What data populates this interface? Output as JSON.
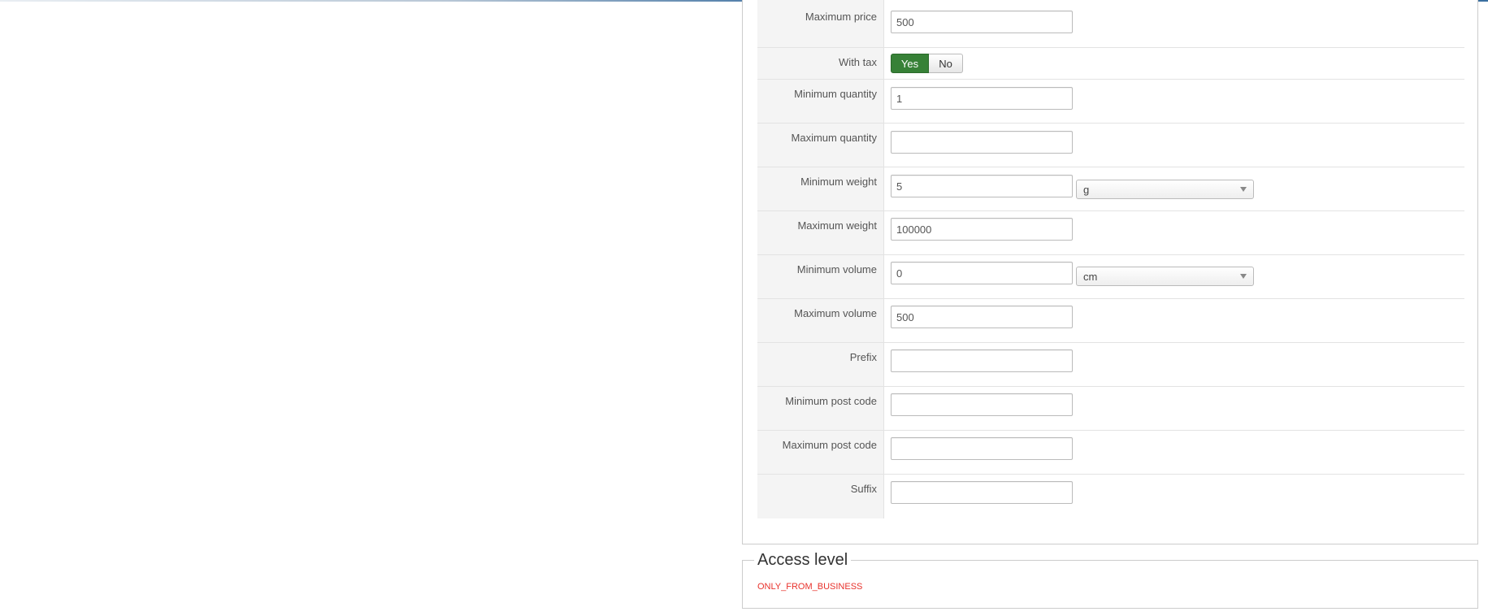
{
  "fields": [
    {
      "label": "Maximum price",
      "value": "500"
    },
    {
      "label": "With tax",
      "toggle": {
        "yes": "Yes",
        "no": "No",
        "selected": "Yes"
      }
    },
    {
      "label": "Minimum quantity",
      "value": "1"
    },
    {
      "label": "Maximum quantity",
      "value": ""
    },
    {
      "label": "Minimum weight",
      "value": "5",
      "unit": "g"
    },
    {
      "label": "Maximum weight",
      "value": "100000"
    },
    {
      "label": "Minimum volume",
      "value": "0",
      "unit": "cm"
    },
    {
      "label": "Maximum volume",
      "value": "500"
    },
    {
      "label": "Prefix",
      "value": ""
    },
    {
      "label": "Minimum post code",
      "value": ""
    },
    {
      "label": "Maximum post code",
      "value": ""
    },
    {
      "label": "Suffix",
      "value": ""
    }
  ],
  "access": {
    "legend": "Access level",
    "text": "ONLY_FROM_BUSINESS"
  },
  "colors": {
    "toggle_active": "#378137",
    "restriction_text": "#e8322c"
  }
}
